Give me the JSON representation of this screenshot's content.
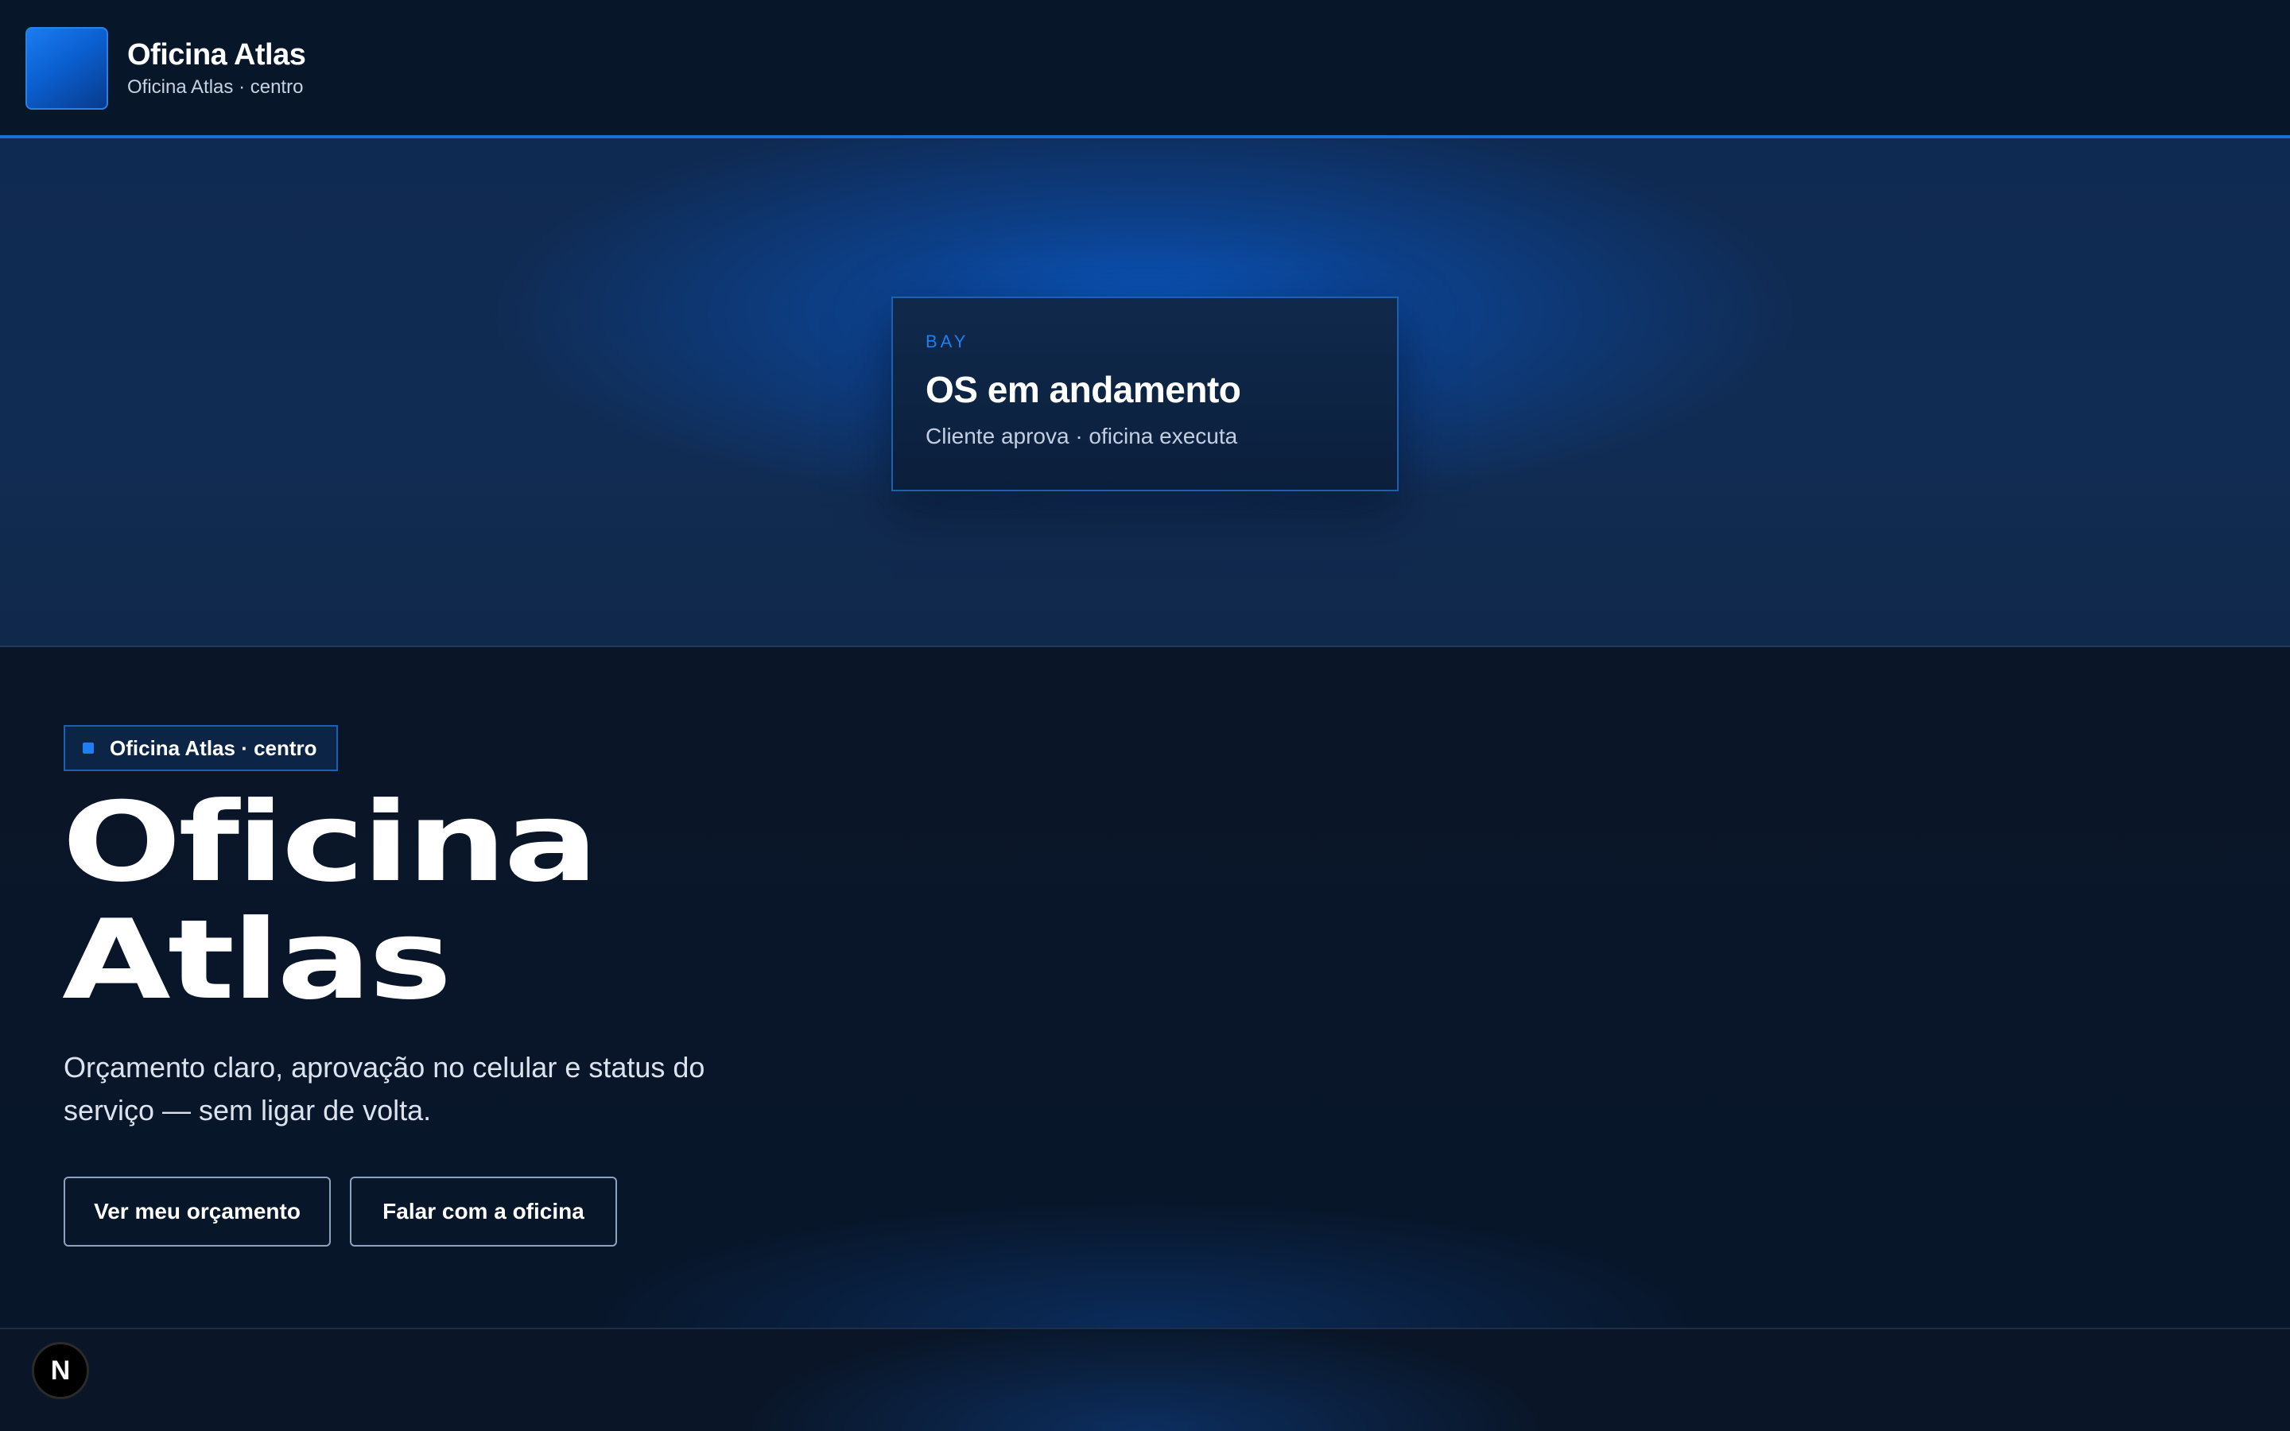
{
  "header": {
    "brand_title": "Oficina Atlas",
    "brand_subtitle": "Oficina Atlas · centro"
  },
  "hero": {
    "card": {
      "eyebrow": "BAY",
      "title": "OS em andamento",
      "subtitle": "Cliente aprova · oficina executa"
    }
  },
  "main": {
    "tag": "Oficina Atlas · centro",
    "title_line1": "Oficina",
    "title_line2": "Atlas",
    "lead": "Orçamento claro, aprovação no celular e status do serviço — sem ligar de volta.",
    "primary_button": "Ver meu orçamento",
    "secondary_button": "Falar com a oficina"
  },
  "footer": {
    "badge_letter": "N"
  },
  "colors": {
    "accent": "#1f7ef2",
    "background": "#0a1628",
    "header_bg": "#071729"
  },
  "icons": {
    "logo": "brand-square-icon",
    "tag_marker": "square-dot-icon",
    "dev_badge": "nextjs-badge-icon"
  }
}
